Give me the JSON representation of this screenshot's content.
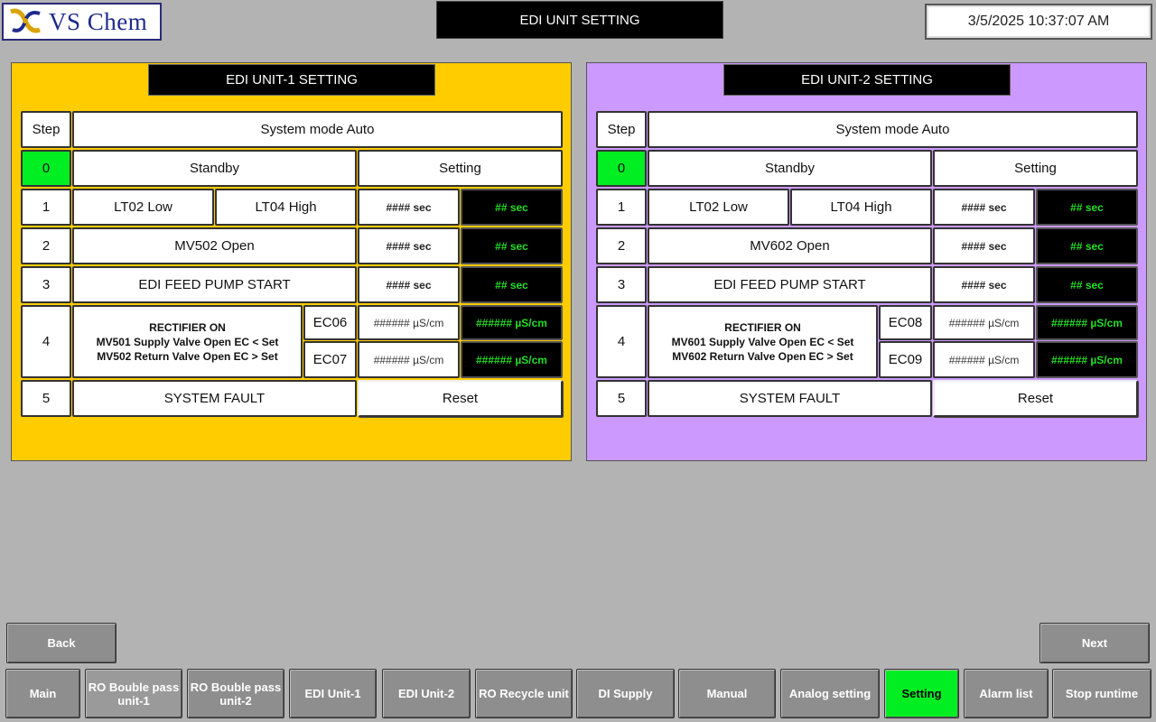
{
  "header": {
    "logo_text": "VS Chem",
    "title": "EDI UNIT SETTING",
    "datetime": "3/5/2025 10:37:07 AM"
  },
  "units": [
    {
      "title": "EDI UNIT-1 SETTING",
      "bg": "#ffcc00",
      "step_header": "Step",
      "mode_header": "System mode Auto",
      "row0": {
        "step": "0",
        "label": "Standby",
        "setting": "Setting"
      },
      "row1": {
        "step": "1",
        "label_a": "LT02 Low",
        "label_b": "LT04 High",
        "set": "#### sec",
        "actual": "## sec"
      },
      "row2": {
        "step": "2",
        "label": "MV502 Open",
        "set": "#### sec",
        "actual": "## sec"
      },
      "row3": {
        "step": "3",
        "label": "EDI FEED PUMP START",
        "set": "#### sec",
        "actual": "## sec"
      },
      "row4": {
        "step": "4",
        "line1": "RECTIFIER ON",
        "line2": "MV501 Supply Valve Open EC < Set",
        "line3": "MV502 Return Valve Open EC > Set",
        "ec_a": "EC06",
        "ec_a_set": "###### µS/cm",
        "ec_a_actual": "###### µS/cm",
        "ec_b": "EC07",
        "ec_b_set": "###### µS/cm",
        "ec_b_actual": "###### µS/cm"
      },
      "row5": {
        "step": "5",
        "label": "SYSTEM FAULT",
        "reset": "Reset"
      }
    },
    {
      "title": "EDI UNIT-2 SETTING",
      "bg": "#cc99ff",
      "step_header": "Step",
      "mode_header": "System mode Auto",
      "row0": {
        "step": "0",
        "label": "Standby",
        "setting": "Setting"
      },
      "row1": {
        "step": "1",
        "label_a": "LT02 Low",
        "label_b": "LT04 High",
        "set": "#### sec",
        "actual": "## sec"
      },
      "row2": {
        "step": "2",
        "label": "MV602 Open",
        "set": "#### sec",
        "actual": "## sec"
      },
      "row3": {
        "step": "3",
        "label": "EDI FEED PUMP START",
        "set": "#### sec",
        "actual": "## sec"
      },
      "row4": {
        "step": "4",
        "line1": "RECTIFIER ON",
        "line2": "MV601 Supply Valve Open EC < Set",
        "line3": "MV602 Return Valve Open EC > Set",
        "ec_a": "EC08",
        "ec_a_set": "###### µS/cm",
        "ec_a_actual": "###### µS/cm",
        "ec_b": "EC09",
        "ec_b_set": "###### µS/cm",
        "ec_b_actual": "###### µS/cm"
      },
      "row5": {
        "step": "5",
        "label": "SYSTEM FAULT",
        "reset": "Reset"
      }
    }
  ],
  "nav": {
    "back": "Back",
    "next": "Next",
    "tabs": [
      "Main",
      "RO Bouble pass unit-1",
      "RO Bouble pass unit-2",
      "EDI Unit-1",
      "EDI Unit-2",
      "RO Recycle unit",
      "DI Supply",
      "Manual",
      "Analog setting",
      "Setting",
      "Alarm list",
      "Stop runtime"
    ],
    "active_tab": "Setting"
  },
  "colors": {
    "accent_green": "#00ee22",
    "header_bg": "#000000",
    "page_bg": "#b3b3b3"
  }
}
